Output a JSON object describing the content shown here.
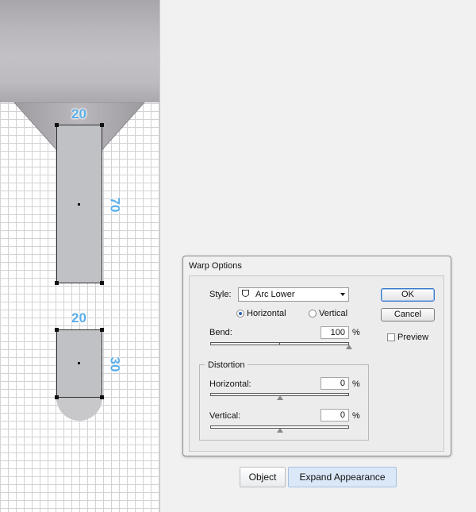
{
  "canvas": {
    "dimensions": {
      "top_width": "20",
      "top_height": "70",
      "bottom_width": "20",
      "bottom_height": "30"
    }
  },
  "dialog": {
    "title": "Warp Options",
    "style_label": "Style:",
    "style_value": "Arc Lower",
    "orientation": {
      "horizontal_label": "Horizontal",
      "vertical_label": "Vertical",
      "selected": "Horizontal"
    },
    "bend": {
      "label": "Bend:",
      "value": "100",
      "unit": "%",
      "level": 1.0
    },
    "distortion": {
      "group_label": "Distortion",
      "horizontal_label": "Horizontal:",
      "horizontal_value": "0",
      "horizontal_unit": "%",
      "horizontal_level": 0.5,
      "vertical_label": "Vertical:",
      "vertical_value": "0",
      "vertical_unit": "%",
      "vertical_level": 0.5
    },
    "ok_label": "OK",
    "cancel_label": "Cancel",
    "preview_label": "Preview",
    "preview_checked": false
  },
  "bottom_bar": {
    "object_label": "Object",
    "expand_label": "Expand Appearance"
  },
  "colors": {
    "dimension_text": "#5aaee8",
    "shape_fill": "#bfc1c4",
    "focus_blue": "#3a78c9"
  },
  "icons": [
    "arc-lower-icon",
    "dropdown-arrow-icon",
    "slider-thumb-icon"
  ]
}
